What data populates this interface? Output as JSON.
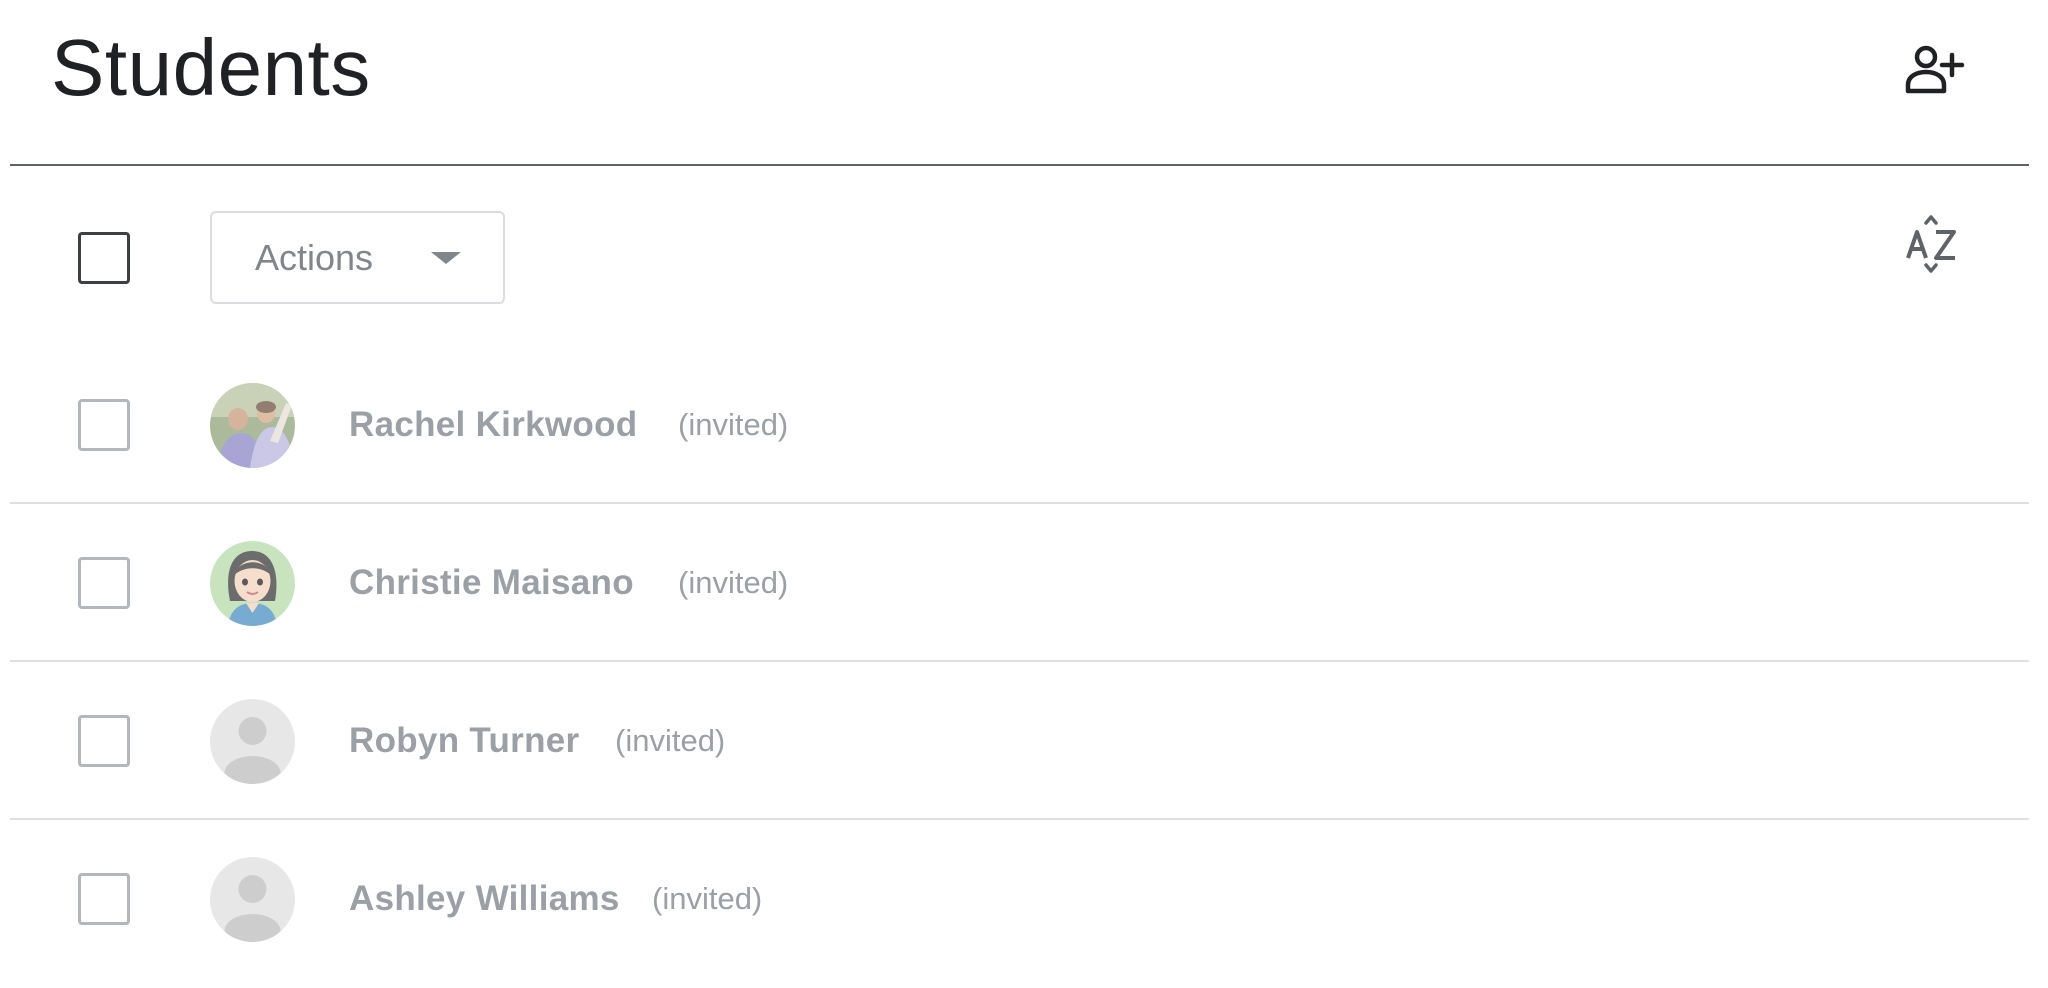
{
  "page": {
    "title": "Students"
  },
  "toolbar": {
    "actions_label": "Actions"
  },
  "icons": {
    "add_student": "person-add-icon",
    "sort": "sort-az-icon",
    "dropdown": "caret-down-icon",
    "default_avatar": "person-silhouette-icon"
  },
  "students": [
    {
      "name": "Rachel Kirkwood",
      "status": "(invited)",
      "avatar": "photo"
    },
    {
      "name": "Christie Maisano",
      "status": "(invited)",
      "avatar": "cartoon"
    },
    {
      "name": "Robyn Turner",
      "status": "(invited)",
      "avatar": "default"
    },
    {
      "name": "Ashley Williams",
      "status": "(invited)",
      "avatar": "default"
    }
  ],
  "colors": {
    "title": "#202124",
    "muted_text": "#9aa0a6",
    "divider": "#e0e0e0",
    "header_divider": "#5f6368"
  }
}
